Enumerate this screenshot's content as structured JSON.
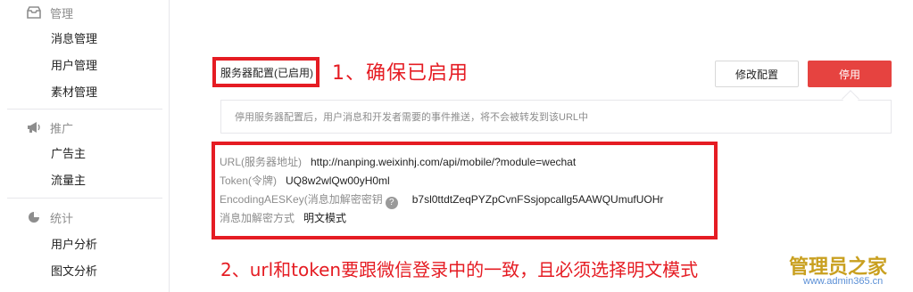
{
  "sidebar": {
    "sections": [
      {
        "title": "管理",
        "icon": "inbox-icon",
        "items": [
          "消息管理",
          "用户管理",
          "素材管理"
        ]
      },
      {
        "title": "推广",
        "icon": "megaphone-icon",
        "items": [
          "广告主",
          "流量主"
        ]
      },
      {
        "title": "统计",
        "icon": "pie-chart-icon",
        "items": [
          "用户分析",
          "图文分析"
        ]
      }
    ]
  },
  "main": {
    "config_title": "服务器配置(已启用)",
    "annotation_1": "1、确保已启用",
    "modify_button": "修改配置",
    "stop_button": "停用",
    "tip": "停用服务器配置后，用户消息和开发者需要的事件推送，将不会被转发到该URL中",
    "fields": {
      "url_label": "URL(服务器地址)",
      "url_value": "http://nanping.weixinhj.com/api/mobile/?module=wechat",
      "token_label": "Token(令牌)",
      "token_value": "UQ8w2wlQw00yH0ml",
      "aes_label": "EncodingAESKey(消息加解密密钥",
      "aes_help": "?",
      "aes_value": "b7sl0ttdtZeqPYZpCvnFSsjopcallg5AAWQUmufUOHr",
      "mode_label": "消息加解密方式",
      "mode_value": "明文模式"
    },
    "annotation_2": "2、url和token要跟微信登录中的一致，且必须选择明文模式"
  },
  "watermark": {
    "text": "管理员之家",
    "url": "www.admin365.cn"
  },
  "colors": {
    "accent_red": "#e51c23",
    "stop_button": "#e64340"
  }
}
